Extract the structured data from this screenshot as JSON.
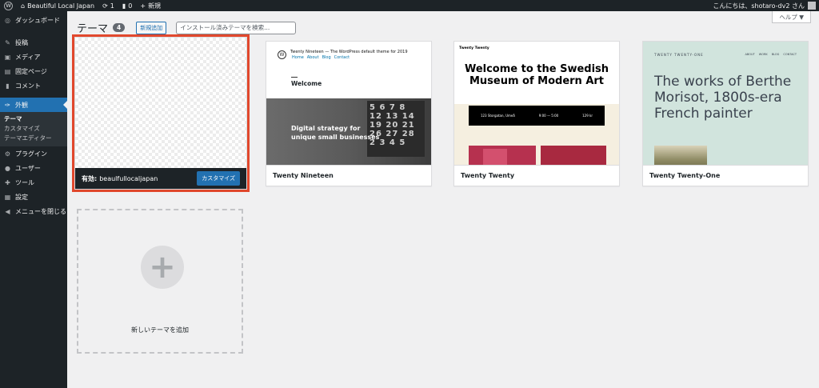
{
  "adminbar": {
    "site_name": "Beautiful Local Japan",
    "updates_count": "1",
    "comments_count": "0",
    "new_label": "新規",
    "greeting": "こんにちは、shotaro-dv2 さん"
  },
  "sidebar": {
    "items": [
      {
        "label": "ダッシュボード",
        "icon": "dashboard-icon"
      },
      {
        "label": "投稿",
        "icon": "pin-icon"
      },
      {
        "label": "メディア",
        "icon": "media-icon"
      },
      {
        "label": "固定ページ",
        "icon": "page-icon"
      },
      {
        "label": "コメント",
        "icon": "comment-icon"
      },
      {
        "label": "外観",
        "icon": "appearance-icon"
      },
      {
        "label": "プラグイン",
        "icon": "plugin-icon"
      },
      {
        "label": "ユーザー",
        "icon": "user-icon"
      },
      {
        "label": "ツール",
        "icon": "tools-icon"
      },
      {
        "label": "設定",
        "icon": "settings-icon"
      },
      {
        "label": "メニューを閉じる",
        "icon": "collapse-icon"
      }
    ],
    "submenu": [
      "テーマ",
      "カスタマイズ",
      "テーマエディター"
    ]
  },
  "help_label": "ヘルプ ▼",
  "header": {
    "title": "テーマ",
    "count": "4",
    "add_new_label": "新規追加",
    "search_placeholder": "インストール済みテーマを検索..."
  },
  "themes": {
    "active": {
      "active_label": "有効:",
      "name": "beaulfullocaljapan",
      "customize_label": "カスタマイズ"
    },
    "t19": {
      "name": "Twenty Nineteen",
      "site_title": "Twenty Nineteen — The WordPress default theme for 2019",
      "nav": [
        "Home",
        "About",
        "Blog",
        "Contact"
      ],
      "welcome": "Welcome",
      "tagline_1": "Digital strategy for",
      "tagline_2": "unique small businesses"
    },
    "t20": {
      "name": "Twenty Twenty",
      "brand": "Twenty Twenty",
      "headline_1": "Welcome to the Swedish",
      "headline_2": "Museum of Modern Art",
      "band_1": "123 Storgatan, Umeå",
      "band_2": "9:00 — 5:00",
      "band_3": "129 kr"
    },
    "t21": {
      "name": "Twenty Twenty-One",
      "brand": "TWENTY TWENTY-ONE",
      "nav": [
        "ABOUT",
        "WORK",
        "BLOG",
        "CONTACT"
      ],
      "headline": "The works of Berthe Morisot, 1800s-era French painter"
    }
  },
  "add_theme_label": "新しいテーマを追加",
  "colors": {
    "accent": "#2271b1",
    "highlight_frame": "#e2482d",
    "sidebar_bg": "#1d2327"
  }
}
